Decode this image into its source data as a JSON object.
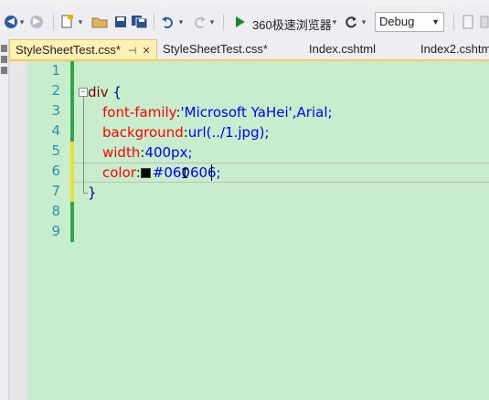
{
  "toolbar": {
    "run_browser_label": "360极速浏览器",
    "configuration": "Debug"
  },
  "tabs": [
    {
      "label": "StyleSheetTest.css*",
      "active": true
    },
    {
      "label": "StyleSheetTest.css*",
      "active": false
    },
    {
      "label": "Index.cshtml",
      "active": false
    },
    {
      "label": "Index2.cshtm",
      "active": false
    }
  ],
  "editor": {
    "line_numbers": [
      "1",
      "2",
      "3",
      "4",
      "5",
      "6",
      "7",
      "8",
      "9"
    ],
    "code": {
      "l2_selector": "div",
      "l2_brace": " {",
      "l3_prop": "font-family",
      "l3_colon": ":",
      "l3_value": "'Microsoft YaHei',Arial;",
      "l4_prop": "background",
      "l4_colon": ":",
      "l4_value": "url(../1.jpg);",
      "l5_prop": "width",
      "l5_colon": ":",
      "l5_value": "400px;",
      "l6_prop": "color",
      "l6_colon": ":",
      "l6_value": "#060606;",
      "l7_brace": "}"
    },
    "swatch_color": "#060606",
    "background_color": "#c7edcc"
  }
}
